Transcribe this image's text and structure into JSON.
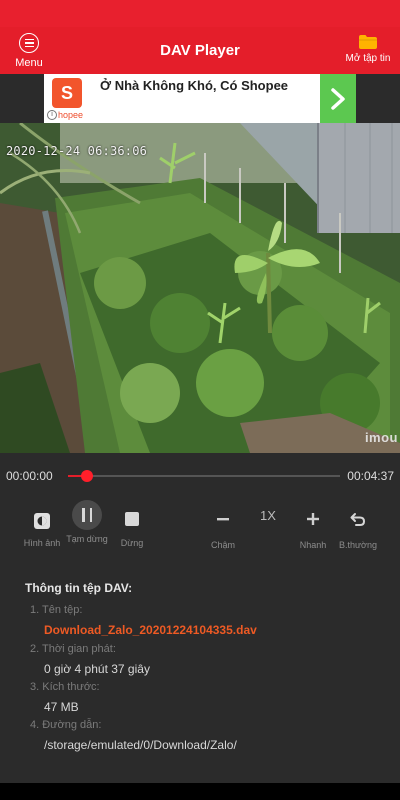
{
  "app": {
    "title": "DAV Player",
    "menu_label": "Menu",
    "open_file_label": "Mở tập tin"
  },
  "ad": {
    "text": "Ở Nhà Không Khó, Có Shopee",
    "brand": "hopee",
    "logo_letter": "S"
  },
  "video": {
    "timestamp": "2020-12-24 06:36:06",
    "watermark": "imou"
  },
  "player": {
    "current_time": "00:00:00",
    "total_time": "00:04:37",
    "progress": 0.07,
    "speed": "1X",
    "buttons": {
      "snapshot": "Hình ảnh",
      "pause": "Tạm dừng",
      "stop": "Dừng",
      "slower": "Chậm",
      "faster": "Nhanh",
      "normal": "B.thường"
    }
  },
  "file_info": {
    "title": "Thông tin tệp DAV:",
    "items": [
      {
        "label": "1. Tên tệp:",
        "value": "Download_Zalo_20201224104335.dav"
      },
      {
        "label": "2. Thời gian phát:",
        "value": "0 giờ 4 phút 37 giây"
      },
      {
        "label": "3. Kích thước:",
        "value": "47 MB"
      },
      {
        "label": "4. Đường dẫn:",
        "value": "/storage/emulated/0/Download/Zalo/"
      }
    ]
  },
  "colors": {
    "accent": "#e41e2a",
    "file_name": "#ee5a24",
    "background": "#2b2b2b"
  }
}
